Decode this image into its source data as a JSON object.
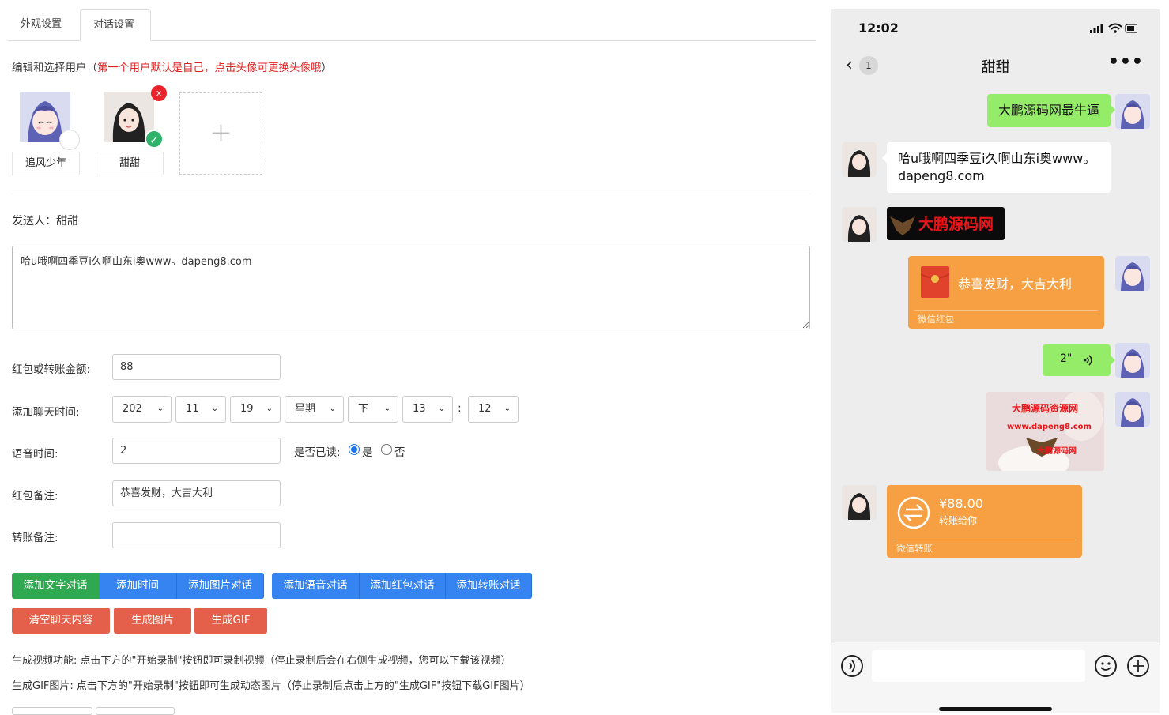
{
  "tabs": [
    {
      "label": "外观设置"
    },
    {
      "label": "对话设置"
    }
  ],
  "hint": {
    "prefix": "编辑和选择用户（",
    "red": "第一个用户默认是自己，点击头像可更换头像哦",
    "suffix": "）"
  },
  "users": [
    {
      "name": "追风少年"
    },
    {
      "name": "甜甜"
    }
  ],
  "add_user": "+",
  "delete_mark": "x",
  "check_mark": "✓",
  "sender": "发送人：甜甜",
  "message_text": "哈u哦啊四季豆i久啊山东i奥www。dapeng8.com",
  "labels": {
    "amount": "红包或转账金额:",
    "time": "添加聊天时间:",
    "voice": "语音时间:",
    "rp_note": "红包备注:",
    "tr_note": "转账备注:"
  },
  "values": {
    "amount": "88",
    "voice": "2",
    "rp_note": "恭喜发财，大吉大利",
    "tr_note": ""
  },
  "time_selects": [
    "202",
    "11",
    "19",
    "星期",
    "下",
    "13",
    "12"
  ],
  "time_colon": ":",
  "read": {
    "label": "是否已读:",
    "yes": "是",
    "no": "否"
  },
  "buttons": {
    "add_text": "添加文字对话",
    "add_time": "添加时间",
    "add_image": "添加图片对话",
    "add_voice": "添加语音对话",
    "add_rp": "添加红包对话",
    "add_transfer": "添加转账对话",
    "clear": "清空聊天内容",
    "gen_image": "生成图片",
    "gen_gif": "生成GIF"
  },
  "notes": {
    "video": "生成视频功能: 点击下方的\"开始录制\"按钮即可录制视频（停止录制后会在右侧生成视频，您可以下载该视频）",
    "gif": "生成GIF图片: 点击下方的\"开始录制\"按钮即可生成动态图片（停止录制后点击上方的\"生成GIF\"按钮下载GIF图片）"
  },
  "phone": {
    "time": "12:02",
    "back_icon": "‹",
    "badge": "1",
    "title": "甜甜",
    "more": "•••",
    "messages": {
      "m1": "大鹏源码网最牛逼",
      "m2": "哈u哦啊四季豆i久啊山东i奥www。dapeng8.com",
      "logo_text": "大鹏源码网",
      "rp_text": "恭喜发财，大吉大利",
      "rp_foot": "微信红包",
      "voice": "2\"",
      "photo_line1": "大鹏源码资源网",
      "photo_line2": "www.dapeng8.com",
      "photo_line3": "大鹏源码网",
      "tr_amount": "¥88.00",
      "tr_sub": "转账给你",
      "tr_foot": "微信转账"
    }
  },
  "colors": {
    "green_btn": "#2fa84f",
    "blue_btn": "#3584f2",
    "orange_btn": "#e4604a",
    "wechat_green": "#95ec69",
    "redpacket": "#f7a043"
  }
}
